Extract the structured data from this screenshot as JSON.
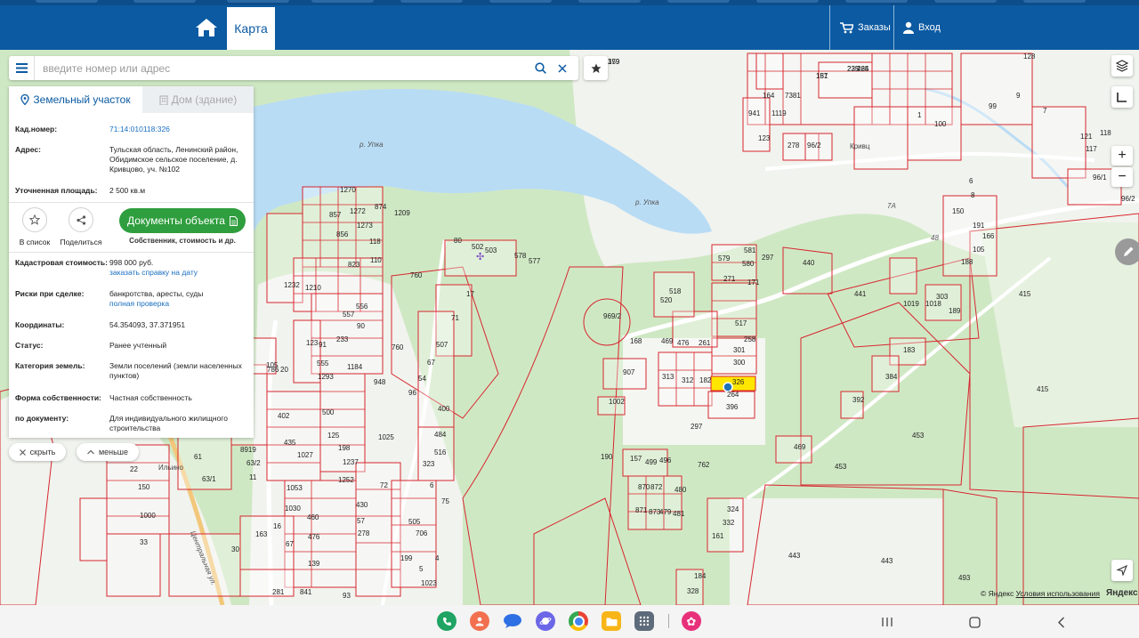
{
  "header": {
    "tab_map": "Карта",
    "orders_label": "Заказы",
    "login_label": "Вход"
  },
  "search": {
    "placeholder": "введите номер или адрес"
  },
  "panel": {
    "tab_land": "Земельный участок",
    "tab_house": "Дом (здание)",
    "fields": {
      "cad_label": "Кад.номер:",
      "cad_value": "71:14:010118:326",
      "address_label": "Адрес:",
      "address_value": "Тульская область, Ленинский район, Обидимское сельское поселение, д. Кривцово, уч. №102",
      "area_label": "Уточненная площадь:",
      "area_value": "2 500 кв.м",
      "cost_label": "Кадастровая стоимость:",
      "cost_value": "998 000 руб.",
      "cost_link": "заказать справку на дату",
      "risk_label": "Риски при сделке:",
      "risk_value": "банкротства, аресты, суды",
      "risk_link": "полная проверка",
      "coords_label": "Координаты:",
      "coords_value": "54.354093, 37.371951",
      "status_label": "Статус:",
      "status_value": "Ранее учтенный",
      "category_label": "Категория земель:",
      "category_value": "Земли поселений (земли населенных пунктов)",
      "ownership_label": "Форма собственности:",
      "ownership_value": "Частная собственность",
      "bydoc_label": "по документу:",
      "bydoc_value": "Для индивидуального жилищного строительства"
    },
    "actions": {
      "to_list": "В список",
      "share": "Поделиться",
      "documents": "Документы объекта",
      "documents_sub": "Собственник, стоимость и др."
    },
    "hide_label": "скрыть",
    "less_label": "меньше"
  },
  "map": {
    "copyright": "© Яндекс",
    "terms": "Условия использования",
    "logo": "Яндекс",
    "place_labels": [
      "р. Упка",
      "р. Упка",
      "Кривц",
      "Ильино",
      "Центральная ул.",
      "7А",
      "48"
    ],
    "plot_labels": [
      "359",
      "151",
      "235",
      "465",
      "164",
      "7381",
      "941",
      "1119",
      "123",
      "278",
      "96/2",
      "121",
      "117",
      "118",
      "96/1",
      "96/2",
      "150",
      "191",
      "166",
      "105",
      "188",
      "303",
      "189",
      "183",
      "384",
      "392",
      "415",
      "415",
      "453",
      "453",
      "469",
      "440",
      "441",
      "1018",
      "1019",
      "579",
      "581",
      "580",
      "297",
      "271",
      "171",
      "517",
      "258",
      "301",
      "300",
      "326",
      "264",
      "396",
      "313",
      "312",
      "182",
      "907",
      "1002",
      "297",
      "762",
      "190",
      "157",
      "499",
      "496",
      "870",
      "872",
      "480",
      "871",
      "873",
      "479",
      "481",
      "324",
      "332",
      "161",
      "184",
      "328",
      "443",
      "443",
      "493",
      "520",
      "518",
      "969/2",
      "168",
      "469",
      "476",
      "261",
      "1270",
      "874",
      "1272",
      "1209",
      "857",
      "1273",
      "856",
      "118",
      "823",
      "110",
      "556",
      "557",
      "90",
      "760",
      "760",
      "80",
      "502",
      "503",
      "578",
      "577",
      "17",
      "71",
      "507",
      "67",
      "54",
      "96",
      "400",
      "948",
      "1025",
      "484",
      "516",
      "323",
      "6",
      "75",
      "505",
      "706",
      "199",
      "1023",
      "22",
      "150",
      "1000",
      "33",
      "63/1",
      "8919",
      "61",
      "63/2",
      "11",
      "402",
      "435",
      "1027",
      "1053",
      "1030",
      "460",
      "476",
      "139",
      "500",
      "125",
      "198",
      "1237",
      "1252",
      "430",
      "278",
      "281",
      "841",
      "93",
      "91",
      "233",
      "555",
      "1293",
      "786",
      "20",
      "105",
      "1184",
      "1210",
      "1232",
      "123",
      "30",
      "163",
      "16",
      "67",
      "72",
      "57",
      "4",
      "5",
      "6",
      "8",
      "7",
      "9",
      "99",
      "100",
      "1",
      "128",
      "179",
      "187",
      "225",
      "224"
    ],
    "selected_plot": "326"
  },
  "colors": {
    "header_bg": "#0b5aa2",
    "accent_green": "#2f9e3e",
    "link_blue": "#1a6fc0",
    "plot_border": "#d7262e",
    "water": "#b9dcf5",
    "forest": "#cfe8c4",
    "selected_fill": "#ffe600"
  },
  "icons": {
    "home": "home-icon",
    "cart": "cart-icon",
    "user": "user-icon",
    "menu": "menu-icon",
    "search": "search-icon",
    "clear": "close-icon",
    "star": "star-icon",
    "layers": "layers-icon",
    "ruler": "ruler-icon",
    "zoom_in": "plus-icon",
    "zoom_out": "minus-icon",
    "locate": "locate-arrow-icon",
    "edit": "pencil-icon"
  }
}
